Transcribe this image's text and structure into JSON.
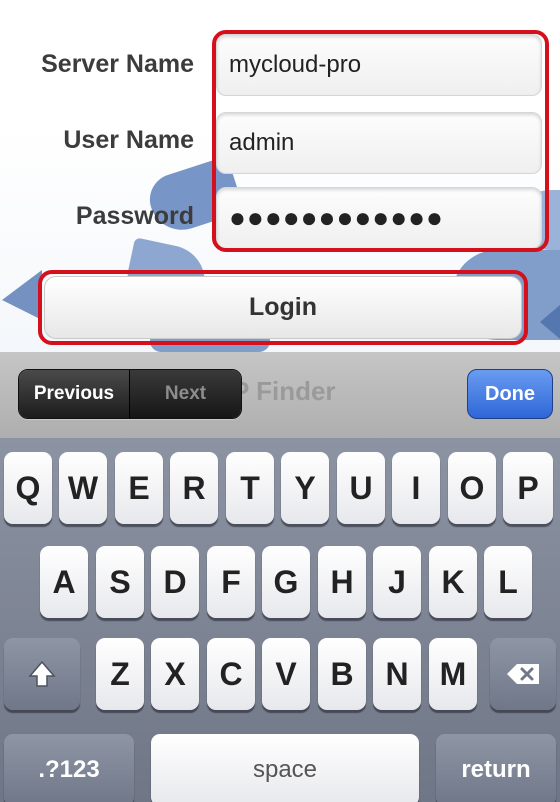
{
  "form": {
    "server_label": "Server Name",
    "server_value": "mycloud-pro",
    "user_label": "User Name",
    "user_value": "admin",
    "password_label": "Password",
    "password_value": "●●●●●●●●●●●●",
    "login_label": "Login"
  },
  "accessory": {
    "previous_label": "Previous",
    "next_label": "Next",
    "done_label": "Done",
    "underlying_text": "P Finder"
  },
  "keyboard": {
    "row1": [
      "Q",
      "W",
      "E",
      "R",
      "T",
      "Y",
      "U",
      "I",
      "O",
      "P"
    ],
    "row2": [
      "A",
      "S",
      "D",
      "F",
      "G",
      "H",
      "J",
      "K",
      "L"
    ],
    "row3": [
      "Z",
      "X",
      "C",
      "V",
      "B",
      "N",
      "M"
    ],
    "shift_icon": "shift-icon",
    "delete_icon": "backspace-icon",
    "numbers_label": ".?123",
    "space_label": "space",
    "return_label": "return"
  },
  "colors": {
    "highlight": "#d4101c",
    "done_button": "#2e66d8",
    "keyboard_bg": "#7d8493"
  }
}
